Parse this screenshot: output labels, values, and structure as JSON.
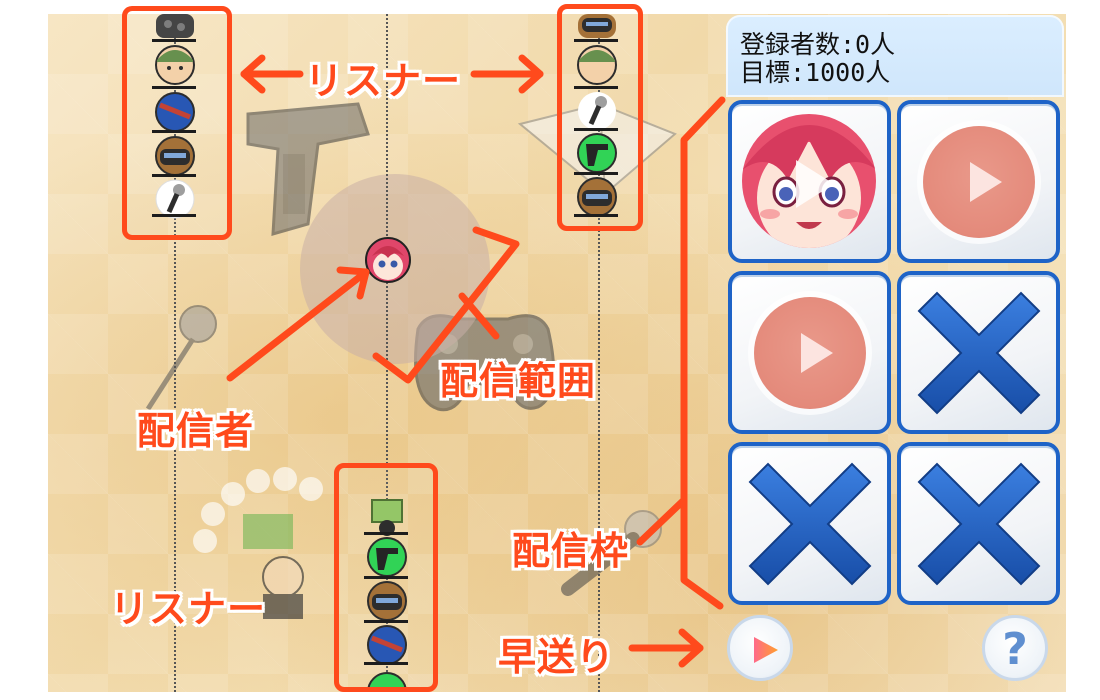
{
  "stats": {
    "subscribers_line": "登録者数:0人",
    "goal_line": "目標:1000人"
  },
  "annotations": {
    "listener_top": "リスナー",
    "streamer": "配信者",
    "stream_range": "配信範囲",
    "stream_slots": "配信枠",
    "listener_bottom": "リスナー",
    "fast_forward": "早送り"
  },
  "slots": [
    {
      "state": "active-streamer",
      "icon": "streamer-avatar-play-icon"
    },
    {
      "state": "empty-play",
      "icon": "play-icon"
    },
    {
      "state": "empty-play",
      "icon": "play-icon"
    },
    {
      "state": "locked",
      "icon": "x-icon"
    },
    {
      "state": "locked",
      "icon": "x-icon"
    },
    {
      "state": "locked",
      "icon": "x-icon"
    }
  ],
  "controls": {
    "fast_forward_icon": "play-icon",
    "help_glyph": "?"
  },
  "colors": {
    "annotation": "#ff4a1c",
    "slot_border": "#1e63c7",
    "x_mark": "#1f5fbf",
    "stats_bg": "#d6ebfd"
  }
}
